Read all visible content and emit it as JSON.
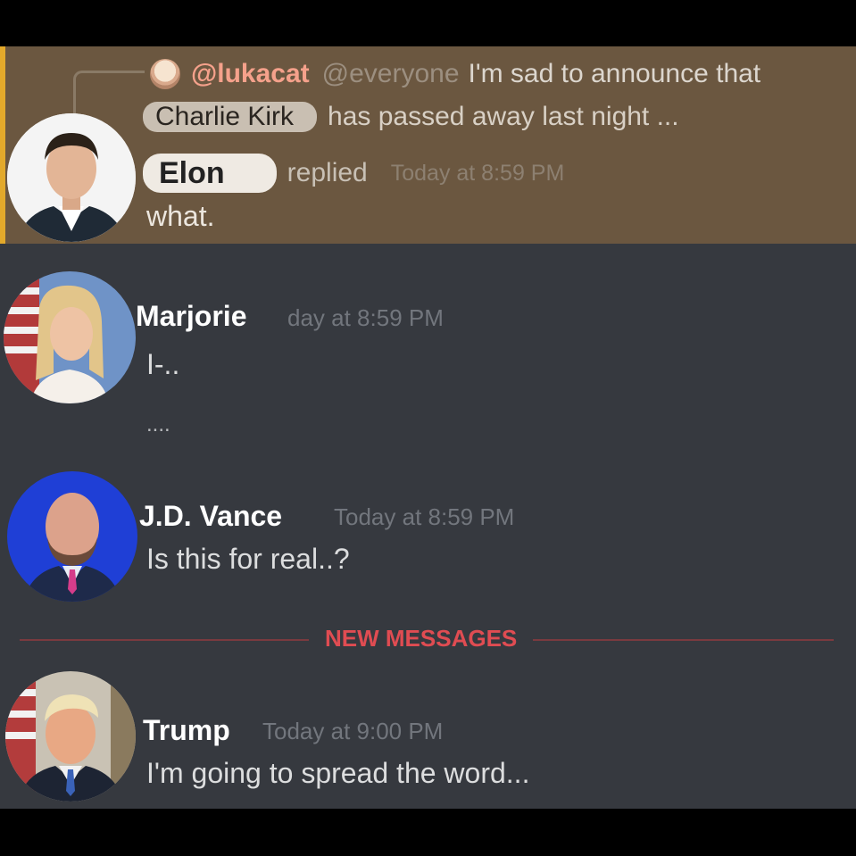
{
  "reply": {
    "username": "@lukacat",
    "mention": "@everyone",
    "text_line1": "I'm sad to announce that",
    "name_pill": "Charlie Kirk",
    "text_line2": "has passed away last night ..."
  },
  "messages": [
    {
      "username": "Elon",
      "action": "replied",
      "timestamp": "Today at 8:59 PM",
      "text": "what."
    },
    {
      "username": "Marjorie",
      "timestamp": "day at 8:59 PM",
      "text": "I-..",
      "text2": "...."
    },
    {
      "username": "J.D. Vance",
      "timestamp": "Today at 8:59 PM",
      "text": "Is this for real..?"
    },
    {
      "username": "Trump",
      "timestamp": "Today at 9:00 PM",
      "text": "I'm going to spread the word..."
    }
  ],
  "divider": {
    "label": "NEW MESSAGES"
  },
  "colors": {
    "background": "#36393f",
    "highlight": "#6b5740",
    "highlight_bar": "#e3a92b",
    "new_messages": "#e04c52"
  },
  "icons": {
    "reply_avatar": "anime-avatar-icon",
    "avatars": [
      "elon-avatar",
      "marjorie-avatar",
      "vance-avatar",
      "trump-avatar"
    ]
  }
}
